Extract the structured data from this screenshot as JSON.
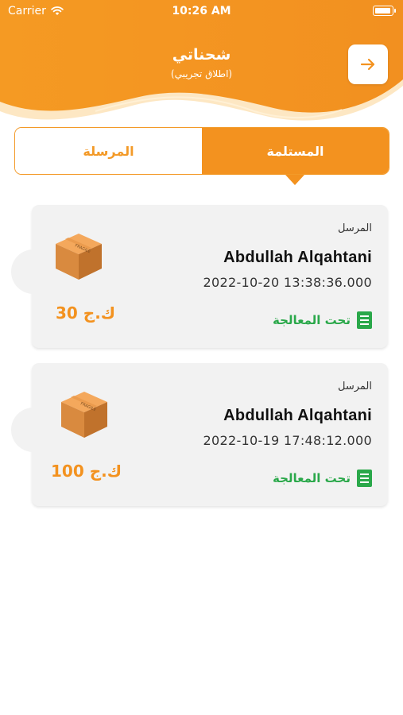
{
  "status_bar": {
    "carrier": "Carrier",
    "time": "10:26 AM"
  },
  "header": {
    "title": "شحناتي",
    "subtitle": "(اطلاق تجريبي)"
  },
  "tabs": {
    "sent": "المرسلة",
    "received": "المستلمة",
    "selected": "received"
  },
  "shipments": [
    {
      "label": "المرسل",
      "name": "Abdullah Alqahtani",
      "datetime": "2022-10-20 13:38:36.000",
      "status": "تحت المعالجة",
      "price": "30 ك.ج"
    },
    {
      "label": "المرسل",
      "name": "Abdullah Alqahtani",
      "datetime": "2022-10-19 17:48:12.000",
      "status": "تحت المعالجة",
      "price": "100 ك.ج"
    }
  ],
  "colors": {
    "accent": "#f3921f",
    "status_green": "#2aa84a",
    "card_bg": "#f2f2f2"
  },
  "icons": {
    "back": "arrow-right-icon",
    "status": "document-icon",
    "package": "package-box-icon",
    "wifi": "wifi-icon",
    "battery": "battery-icon"
  }
}
